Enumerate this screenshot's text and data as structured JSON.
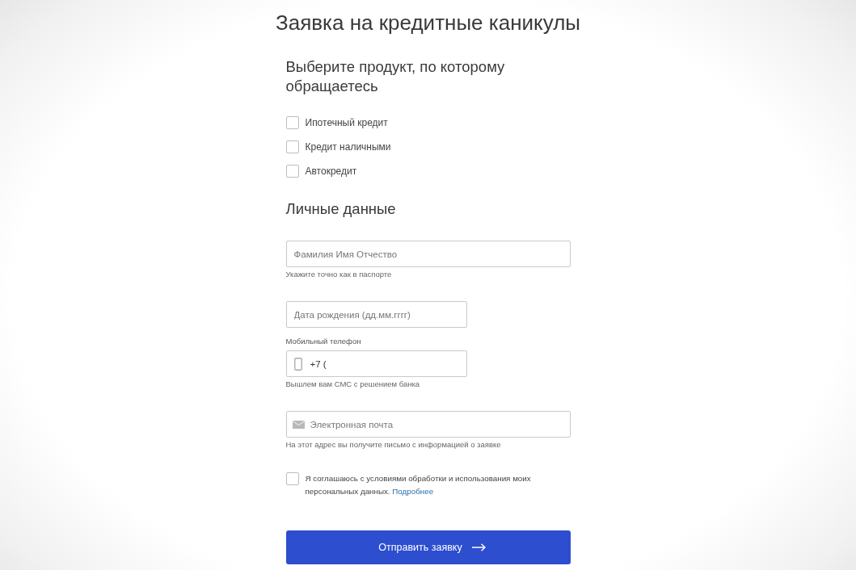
{
  "page": {
    "title": "Заявка на кредитные каникулы"
  },
  "product_section": {
    "heading": "Выберите продукт, по которому обращаетесь",
    "options": [
      {
        "label": "Ипотечный кредит",
        "checked": false
      },
      {
        "label": "Кредит наличными",
        "checked": false
      },
      {
        "label": "Автокредит",
        "checked": false
      }
    ]
  },
  "personal_section": {
    "heading": "Личные данные",
    "fields": [
      {
        "kind": "name",
        "placeholder": "Фамилия Имя Отчество",
        "hint": "Укажите точно как в паспорте"
      },
      {
        "kind": "date",
        "placeholder": "Дата рождения (дд.мм.гггг)"
      },
      {
        "kind": "phone",
        "label": "Мобильный телефон",
        "value": "+7 (",
        "hint": "Вышлем вам СМС с решением банка"
      },
      {
        "kind": "email",
        "placeholder": "Электронная почта",
        "hint": "На этот адрес вы получите письмо с информацией о заявке"
      }
    ]
  },
  "consent": {
    "checked": false,
    "text": "Я соглашаюсь с условиями обработки и использования моих персональных данных.",
    "link": "Подробнее"
  },
  "submit": {
    "label": "Отправить заявку"
  }
}
